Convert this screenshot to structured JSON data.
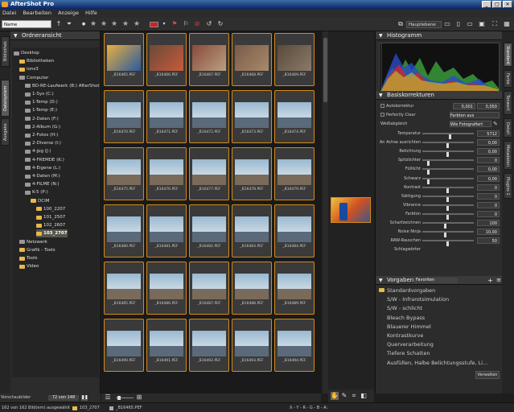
{
  "window": {
    "title": "AfterShot Pro",
    "controls": [
      "_",
      "□",
      "✕"
    ]
  },
  "menu": [
    "Datei",
    "Bearbeiten",
    "Anzeige",
    "Hilfe"
  ],
  "toolbar": {
    "sort_value": "Name",
    "workspace_value": "Hauptebene"
  },
  "left_tabs": [
    "Bibliothek",
    "Dateisystem",
    "Ausgabe"
  ],
  "left_panel": {
    "title": "Ordneransicht",
    "footer_label": "Vorschaubilder",
    "count": "72 von 148"
  },
  "tree": [
    {
      "label": "Desktop",
      "depth": 0,
      "kind": "drv"
    },
    {
      "label": "Bibliotheken",
      "depth": 1,
      "kind": "fold"
    },
    {
      "label": "ions3",
      "depth": 1,
      "kind": "fold"
    },
    {
      "label": "Computer",
      "depth": 1,
      "kind": "drv"
    },
    {
      "label": "BD-RE-Laufwerk (B:) AfterShot",
      "depth": 2,
      "kind": "drv"
    },
    {
      "label": "1-Sys (C:)",
      "depth": 2,
      "kind": "drv"
    },
    {
      "label": "1-Temp (D:)",
      "depth": 2,
      "kind": "drv"
    },
    {
      "label": "1-Temp (E:)",
      "depth": 2,
      "kind": "drv"
    },
    {
      "label": "2-Daten (F:)",
      "depth": 2,
      "kind": "drv"
    },
    {
      "label": "2-Album (G:)",
      "depth": 2,
      "kind": "drv"
    },
    {
      "label": "2-Fotos (H:)",
      "depth": 2,
      "kind": "drv"
    },
    {
      "label": "2-Diverse (I:)",
      "depth": 2,
      "kind": "drv"
    },
    {
      "label": "4-jpg (J:)",
      "depth": 2,
      "kind": "drv"
    },
    {
      "label": "4-FREMDE (K:)",
      "depth": 2,
      "kind": "drv"
    },
    {
      "label": "4-Eigene (L:)",
      "depth": 2,
      "kind": "drv"
    },
    {
      "label": "4-Daten (M:)",
      "depth": 2,
      "kind": "drv"
    },
    {
      "label": "4-FILME (N:)",
      "depth": 2,
      "kind": "drv"
    },
    {
      "label": "K-5 (P:)",
      "depth": 2,
      "kind": "drv"
    },
    {
      "label": "DCIM",
      "depth": 3,
      "kind": "fold"
    },
    {
      "label": "100_2207",
      "depth": 4,
      "kind": "fold"
    },
    {
      "label": "101_2507",
      "depth": 4,
      "kind": "fold"
    },
    {
      "label": "102_2607",
      "depth": 4,
      "kind": "fold"
    },
    {
      "label": "103_2707",
      "depth": 4,
      "kind": "fold",
      "selected": true
    },
    {
      "label": "Netzwerk",
      "depth": 1,
      "kind": "drv"
    },
    {
      "label": "Grafik - Tools",
      "depth": 1,
      "kind": "fold"
    },
    {
      "label": "Tools",
      "depth": 1,
      "kind": "fold"
    },
    {
      "label": "Video",
      "depth": 1,
      "kind": "fold"
    }
  ],
  "thumbs": [
    "_B16465.PEF",
    "_B16466.PEF",
    "_B16467.PEF",
    "_B16468.PEF",
    "_B16469.PEF",
    "_B16470.PEF",
    "_B16471.PEF",
    "_B16472.PEF",
    "_B16473.PEF",
    "_B16474.PEF",
    "_B16475.PEF",
    "_B16476.PEF",
    "_B16477.PEF",
    "_B16478.PEF",
    "_B16479.PEF",
    "_B16480.PEF",
    "_B16481.PEF",
    "_B16482.PEF",
    "_B16483.PEF",
    "_B16484.PEF",
    "_B16485.PEF",
    "_B16486.PEF",
    "_B16487.PEF",
    "_B16488.PEF",
    "_B16489.PEF",
    "_B16490.PEF",
    "_B16491.PEF",
    "_B16492.PEF",
    "_B16493.PEF",
    "_B16494.PEF"
  ],
  "right_tabs": [
    "Standard",
    "Farbe",
    "Tonwert",
    "Detail",
    "Metadaten",
    "Plugins 1"
  ],
  "histogram": {
    "title": "Histogramm"
  },
  "basic": {
    "title": "Basiskorrekturen",
    "autokorrektur": "Autokorrektur",
    "auto_val1": "0,001",
    "auto_val2": "0,050",
    "perfectly_clear": "Perfectly Clear",
    "perfectly_clear_value": "Farbton aus",
    "wb_label": "Weißabgleich",
    "wb_value": "Wie Fotografiert"
  },
  "adjustments": [
    {
      "label": "Temperatur",
      "value": "5712",
      "pos": 0.55
    },
    {
      "label": "An Achse ausrichten",
      "value": "0,00",
      "pos": 0.5
    },
    {
      "label": "Belichtung",
      "value": "0,00",
      "pos": 0.5
    },
    {
      "label": "Spitzlichter",
      "value": "0",
      "pos": 0.1
    },
    {
      "label": "Fülllicht",
      "value": "0,00",
      "pos": 0.1
    },
    {
      "label": "Schwarz",
      "value": "0,00",
      "pos": 0.1
    },
    {
      "label": "Kontrast",
      "value": "0",
      "pos": 0.5
    },
    {
      "label": "Sättigung",
      "value": "0",
      "pos": 0.5
    },
    {
      "label": "Vibrance",
      "value": "0",
      "pos": 0.5
    },
    {
      "label": "Farbton",
      "value": "0",
      "pos": 0.5
    },
    {
      "label": "Scharfzeichnen",
      "value": "100",
      "pos": 0.45
    },
    {
      "label": "Noise Ninja",
      "value": "10,00",
      "pos": 0.45
    },
    {
      "label": "RAW-Rauschen",
      "value": "50",
      "pos": 0.5
    },
    {
      "label": "Schlagwörter",
      "value": "",
      "pos": null
    }
  ],
  "presets": {
    "title": "Vorgaben",
    "dropdown": "Favoriten",
    "items": [
      "Standardvorgaben",
      "S/W - Infrarotsimulation",
      "S/W - schlicht",
      "Bleach Bypass",
      "Blauerer Himmel",
      "Kontrastkurve",
      "Querverarbeitung",
      "Tiefere Schatten",
      "Ausfüllen, Halbe Belichtungsstufe, Li..."
    ],
    "manage": "Verwalten"
  },
  "status": {
    "left": "162 von 162 Bild(ern) ausgewählt",
    "folder": "103_2707",
    "file": "_B16465.PEF",
    "coords": "X - Y - R - G - B - A:"
  }
}
